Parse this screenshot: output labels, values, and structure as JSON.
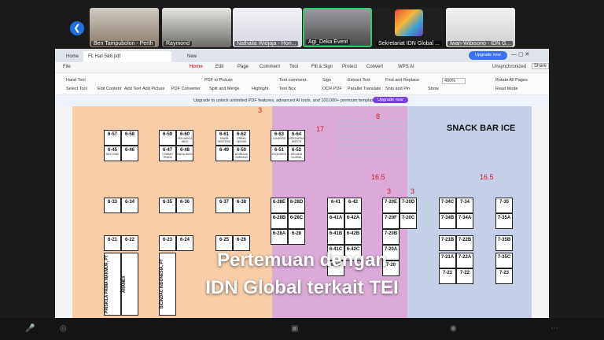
{
  "participants": [
    {
      "name": "Ben Tampubolon - Perth"
    },
    {
      "name": "Raymond"
    },
    {
      "name": "Nathalia Widjaja - Hon..."
    },
    {
      "name": "Agi_Deka Event"
    },
    {
      "name": "Sekretariat IDN Global ..."
    },
    {
      "name": "Iwan-Wibisono - IDN G..."
    }
  ],
  "window": {
    "home_tab": "Home",
    "file_tab": "FL Hall 5&6.pdf",
    "new_tab": "New",
    "upgrade": "Upgrade now"
  },
  "menu": [
    "File",
    "Home",
    "Edit",
    "Page",
    "Comment",
    "Tool",
    "Fill & Sign",
    "Protect",
    "Convert",
    "WPS AI"
  ],
  "menu_right": {
    "sync": "Unsynchronized",
    "share": "Share"
  },
  "ribbon": {
    "hand": "Hand Tool",
    "select": "Select Tool",
    "edit_content": "Edit Content",
    "add_text": "Add Text",
    "add_picture": "Add Picture",
    "pdf_converter": "PDF Converter",
    "pdf_to_picture": "PDF to Picture",
    "split_merge": "Split and Merge",
    "highlight": "Highlight",
    "text_comment": "Text comment",
    "text_box": "Text Box",
    "sign": "Sign",
    "ocr": "OCR PDF",
    "extract": "Extract Text",
    "parallel": "Parallel Translate",
    "find": "Find and Replace",
    "snip": "Snip and Pin",
    "show": "Show",
    "zoom": "400%",
    "rotate": "Rotate All Pages",
    "read_mode": "Read Mode"
  },
  "banner": {
    "text": "Upgrade to unlock unlimited PDF features, advanced AI tools, and 100,000+ premium templates.",
    "button": "Upgrade now"
  },
  "floorplan": {
    "snack": "SNACK BAR ICE",
    "numbers": {
      "n3": "3",
      "n8": "8",
      "n17": "17",
      "n165a": "16.5",
      "n165b": "16.5",
      "n3b": "3",
      "n3c": "3"
    },
    "booths": [
      {
        "id": "6-57",
        "co": ""
      },
      {
        "id": "6-58",
        "co": ""
      },
      {
        "id": "6-59",
        "co": ""
      },
      {
        "id": "6-60",
        "co": "KELUARGA INDO"
      },
      {
        "id": "6-61",
        "co": "SINAR SENTOSA"
      },
      {
        "id": "6-62",
        "co": "PRIMA TEKNIK"
      },
      {
        "id": "6-63",
        "co": "LUNESSE"
      },
      {
        "id": "6-64",
        "co": "INDONESIA WATCH"
      },
      {
        "id": "6-45",
        "co": "DEXTONE"
      },
      {
        "id": "6-46",
        "co": ""
      },
      {
        "id": "6-47",
        "co": "COMMO TRADE"
      },
      {
        "id": "6-48",
        "co": "RAGA INDO"
      },
      {
        "id": "6-49",
        "co": ""
      },
      {
        "id": "6-50",
        "co": "ADIMULIA SARIMAS"
      },
      {
        "id": "6-51",
        "co": "EXQUISITE"
      },
      {
        "id": "6-52",
        "co": "SEGARA GLOBAL"
      },
      {
        "id": "6-33",
        "co": ""
      },
      {
        "id": "6-34",
        "co": ""
      },
      {
        "id": "6-35",
        "co": ""
      },
      {
        "id": "6-36",
        "co": ""
      },
      {
        "id": "6-37",
        "co": ""
      },
      {
        "id": "6-38",
        "co": ""
      },
      {
        "id": "6-28E",
        "co": ""
      },
      {
        "id": "6-28D",
        "co": ""
      },
      {
        "id": "6-41",
        "co": ""
      },
      {
        "id": "6-42",
        "co": ""
      },
      {
        "id": "7-20E",
        "co": ""
      },
      {
        "id": "7-20D",
        "co": ""
      },
      {
        "id": "7-34C",
        "co": ""
      },
      {
        "id": "7-34",
        "co": ""
      },
      {
        "id": "7-35",
        "co": ""
      },
      {
        "id": "6-28B",
        "co": ""
      },
      {
        "id": "6-28C",
        "co": ""
      },
      {
        "id": "6-41A",
        "co": ""
      },
      {
        "id": "6-42A",
        "co": ""
      },
      {
        "id": "7-20F",
        "co": ""
      },
      {
        "id": "7-20C",
        "co": ""
      },
      {
        "id": "7-34B",
        "co": ""
      },
      {
        "id": "7-34A",
        "co": ""
      },
      {
        "id": "7-35A",
        "co": ""
      },
      {
        "id": "6-21",
        "co": ""
      },
      {
        "id": "6-22",
        "co": ""
      },
      {
        "id": "6-23",
        "co": ""
      },
      {
        "id": "6-24",
        "co": ""
      },
      {
        "id": "6-25",
        "co": ""
      },
      {
        "id": "6-26",
        "co": ""
      },
      {
        "id": "6-28A",
        "co": ""
      },
      {
        "id": "6-28",
        "co": ""
      },
      {
        "id": "6-41B",
        "co": ""
      },
      {
        "id": "6-42B",
        "co": ""
      },
      {
        "id": "7-20B",
        "co": ""
      },
      {
        "id": "7-21B",
        "co": ""
      },
      {
        "id": "7-22B",
        "co": ""
      },
      {
        "id": "7-35B",
        "co": ""
      },
      {
        "id": "6-41C",
        "co": ""
      },
      {
        "id": "6-42C",
        "co": ""
      },
      {
        "id": "7-20A",
        "co": ""
      },
      {
        "id": "7-21A",
        "co": ""
      },
      {
        "id": "7-22A",
        "co": ""
      },
      {
        "id": "7-35C",
        "co": ""
      },
      {
        "id": "6-43",
        "co": ""
      },
      {
        "id": "7-20",
        "co": ""
      },
      {
        "id": "7-21",
        "co": ""
      },
      {
        "id": "7-22",
        "co": ""
      },
      {
        "id": "7-23",
        "co": ""
      }
    ],
    "vertical": {
      "v1": "PRISKILA PRIMA MAKMUR, PT",
      "v2": "ARAMEX",
      "v3": "BICINDAC INDONESIA, PT"
    }
  },
  "caption": {
    "line1": "Pertemuan dengan",
    "line2": "IDN Global terkait TEI"
  },
  "colors": {
    "orange": "#f8cda8",
    "pink": "#dcaad8",
    "blue": "#c6cfe8",
    "red": "#d02020",
    "accent": "#1e6fe0"
  }
}
